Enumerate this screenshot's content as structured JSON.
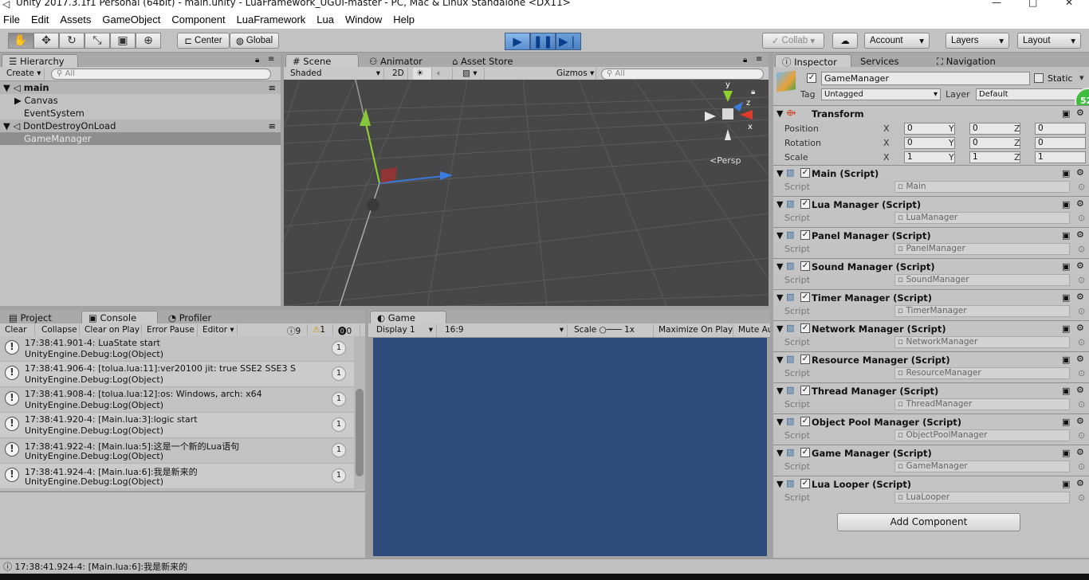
{
  "window": {
    "title": "Unity 2017.3.1f1 Personal (64bit) - main.unity - LuaFramework_UGUI-master - PC, Mac & Linux Standalone <DX11>"
  },
  "menu": [
    "File",
    "Edit",
    "Assets",
    "GameObject",
    "Component",
    "LuaFramework",
    "Lua",
    "Window",
    "Help"
  ],
  "toolbar": {
    "center": "Center",
    "global": "Global",
    "collab": "Collab",
    "account": "Account",
    "layers": "Layers",
    "layout": "Layout"
  },
  "hierarchy": {
    "tab": "Hierarchy",
    "create": "Create",
    "search": "All",
    "items": [
      {
        "label": "main",
        "type": "scene"
      },
      {
        "label": "Canvas",
        "type": "child"
      },
      {
        "label": "EventSystem",
        "type": "child"
      },
      {
        "label": "DontDestroyOnLoad",
        "type": "scene"
      },
      {
        "label": "GameManager",
        "type": "selected"
      }
    ]
  },
  "scene": {
    "tabs": [
      "Scene",
      "Animator",
      "Asset Store"
    ],
    "shaded": "Shaded",
    "mode2d": "2D",
    "gizmos": "Gizmos",
    "search": "All",
    "persp": "Persp",
    "axis_y": "y",
    "axis_z": "z",
    "axis_x": "x"
  },
  "console": {
    "tabs": [
      "Project",
      "Console",
      "Profiler"
    ],
    "buttons": [
      "Clear",
      "Collapse",
      "Clear on Play",
      "Error Pause",
      "Editor"
    ],
    "counts": {
      "logs": "9",
      "warnings": "1",
      "errors": "0"
    },
    "entries": [
      {
        "line1": "17:38:41.901-4: LuaState start",
        "line2": "UnityEngine.Debug:Log(Object)",
        "count": "1"
      },
      {
        "line1": "17:38:41.906-4: [tolua.lua:11]:ver20100 jit:    true    SSE2    SSE3    S",
        "line2": "UnityEngine.Debug:Log(Object)",
        "count": "1"
      },
      {
        "line1": "17:38:41.908-4: [tolua.lua:12]:os: Windows, arch: x64",
        "line2": "UnityEngine.Debug:Log(Object)",
        "count": "1"
      },
      {
        "line1": "17:38:41.920-4: [Main.lua:3]:logic start",
        "line2": "UnityEngine.Debug:Log(Object)",
        "count": "1"
      },
      {
        "line1": "17:38:41.922-4: [Main.lua:5]:这是一个新的Lua语句",
        "line2": "UnityEngine.Debug:Log(Object)",
        "count": "1"
      },
      {
        "line1": "17:38:41.924-4: [Main.lua:6]:我是新来的",
        "line2": "UnityEngine.Debug:Log(Object)",
        "count": "1"
      }
    ]
  },
  "game": {
    "tab": "Game",
    "display": "Display 1",
    "aspect": "16:9",
    "scale_label": "Scale",
    "scale_value": "1x",
    "maximize": "Maximize On Play",
    "mute": "Mute Au"
  },
  "inspector": {
    "tabs": [
      "Inspector",
      "Services",
      "Navigation"
    ],
    "object_name": "GameManager",
    "static": "Static",
    "tag_label": "Tag",
    "tag": "Untagged",
    "layer_label": "Layer",
    "layer": "Default",
    "badge": "52",
    "transform": {
      "title": "Transform",
      "rows": [
        {
          "label": "Position",
          "x": "0",
          "y": "0",
          "z": "0"
        },
        {
          "label": "Rotation",
          "x": "0",
          "y": "0",
          "z": "0"
        },
        {
          "label": "Scale",
          "x": "1",
          "y": "1",
          "z": "1"
        }
      ]
    },
    "script_label": "Script",
    "components": [
      {
        "title": "Main (Script)",
        "script": "Main"
      },
      {
        "title": "Lua Manager (Script)",
        "script": "LuaManager"
      },
      {
        "title": "Panel Manager (Script)",
        "script": "PanelManager"
      },
      {
        "title": "Sound Manager (Script)",
        "script": "SoundManager"
      },
      {
        "title": "Timer Manager (Script)",
        "script": "TimerManager"
      },
      {
        "title": "Network Manager (Script)",
        "script": "NetworkManager"
      },
      {
        "title": "Resource Manager (Script)",
        "script": "ResourceManager"
      },
      {
        "title": "Thread Manager (Script)",
        "script": "ThreadManager"
      },
      {
        "title": "Object Pool Manager (Script)",
        "script": "ObjectPoolManager"
      },
      {
        "title": "Game Manager (Script)",
        "script": "GameManager"
      },
      {
        "title": "Lua Looper (Script)",
        "script": "LuaLooper"
      }
    ],
    "add_component": "Add Component"
  },
  "status": {
    "message": "17:38:41.924-4: [Main.lua:6]:我是新来的"
  }
}
